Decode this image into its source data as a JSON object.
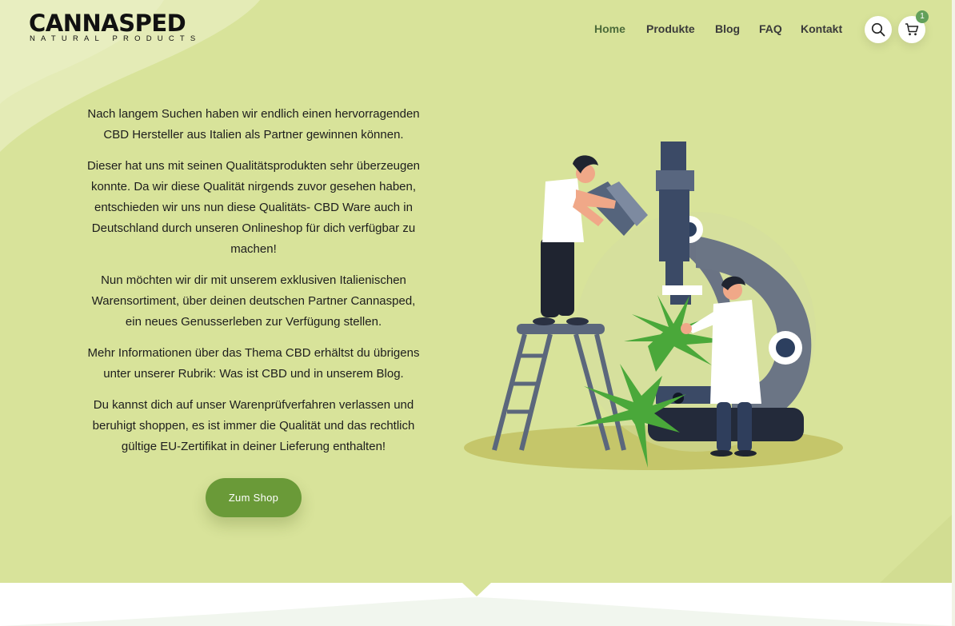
{
  "brand": {
    "name": "CANNASPED",
    "tagline": "NATURAL PRODUCTS"
  },
  "nav": {
    "items": [
      {
        "label": "Home",
        "active": true
      },
      {
        "label": "Produkte",
        "active": false
      },
      {
        "label": "Blog",
        "active": false
      },
      {
        "label": "FAQ",
        "active": false
      },
      {
        "label": "Kontakt",
        "active": false
      }
    ]
  },
  "header_icons": {
    "search_icon": "search-icon",
    "cart_icon": "cart-icon",
    "cart_count": "1"
  },
  "intro": {
    "paragraphs": [
      "Nach langem Suchen haben wir endlich einen hervorragenden CBD Hersteller aus Italien als Partner gewinnen können.",
      "Dieser hat uns mit seinen Qualitätsprodukten sehr überzeugen konnte. Da wir diese Qualität nirgends zuvor gesehen haben, entschieden wir uns nun diese Qualitäts- CBD Ware auch in Deutschland durch unseren Onlineshop für dich verfügbar zu machen!",
      "Nun möchten wir dir mit unserem exklusiven Italienischen Warensortiment, über deinen deutschen Partner Cannasped, ein neues Genusserleben zur Verfügung stellen.",
      "Mehr Informationen über das Thema CBD erhältst du übrigens unter unserer Rubrik: Was ist CBD und in unserem Blog.",
      "Du kannst dich auf unser Warenprüfverfahren verlassen und beruhigt shoppen, es ist immer die Qualität und das rechtlich gültige EU-Zertifikat in deiner Lieferung enthalten!"
    ],
    "cta_label": "Zum Shop"
  },
  "colors": {
    "hero_bg": "#d8e39a",
    "accent_green": "#6a9a38",
    "nav_active": "#4c6b3a",
    "badge": "#62a05a"
  },
  "illustration": "scientists-microscope-cannabis-illustration"
}
